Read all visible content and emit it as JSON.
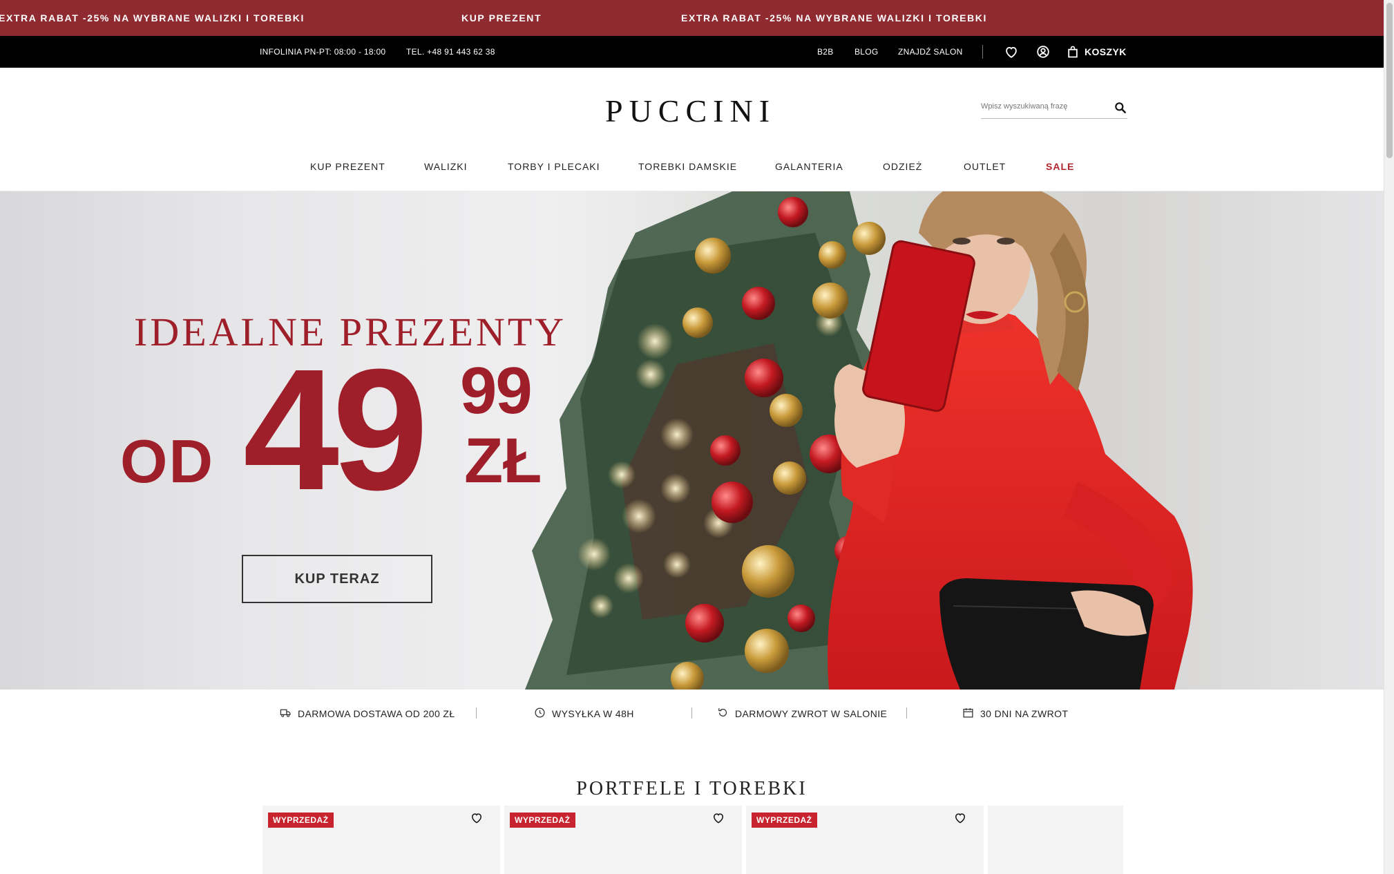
{
  "promo_bar": {
    "messages": [
      "EXTRA RABAT -25% NA WYBRANE WALIZKI I TOREBKI",
      "KUP PREZENT",
      "EXTRA RABAT -25% NA WYBRANE WALIZKI I TOREBKI"
    ],
    "background": "#8e2a30"
  },
  "top_bar": {
    "hotline": "INFOLINIA PN-PT: 08:00 - 18:00",
    "phone": "TEL. +48 91 443 62 38",
    "links": [
      "B2B",
      "BLOG",
      "ZNAJDŹ SALON"
    ],
    "cart_label": "KOSZYK",
    "icons": [
      "heart-icon",
      "user-icon",
      "bag-icon"
    ]
  },
  "header": {
    "logo": "PUCCINI",
    "search_placeholder": "Wpisz wyszukiwaną frazę"
  },
  "nav": {
    "items": [
      "KUP PREZENT",
      "WALIZKI",
      "TORBY I PLECAKI",
      "TOREBKI DAMSKIE",
      "GALANTERIA",
      "ODZIEŻ",
      "OUTLET",
      "SALE"
    ],
    "sale_color": "#b1262e"
  },
  "hero": {
    "title": "IDEALNE PREZENTY",
    "prefix": "OD",
    "price_main": "49",
    "price_cents": "99",
    "currency": "ZŁ",
    "cta": "KUP TERAZ",
    "accent": "#9e1f2a"
  },
  "benefits": [
    {
      "icon": "truck-icon",
      "label": "DARMOWA DOSTAWA OD 200 ZŁ"
    },
    {
      "icon": "clock-icon",
      "label": "WYSYŁKA W 48H"
    },
    {
      "icon": "return-icon",
      "label": "DARMOWY ZWROT W SALONIE"
    },
    {
      "icon": "calendar-icon",
      "label": "30 DNI NA ZWROT"
    }
  ],
  "section": {
    "title": "PORTFELE I TOREBKI",
    "cards": [
      {
        "badge": "WYPRZEDAŻ"
      },
      {
        "badge": "WYPRZEDAŻ"
      },
      {
        "badge": "WYPRZEDAŻ"
      },
      {
        "badge": ""
      }
    ],
    "badge_color": "#c8242f"
  }
}
